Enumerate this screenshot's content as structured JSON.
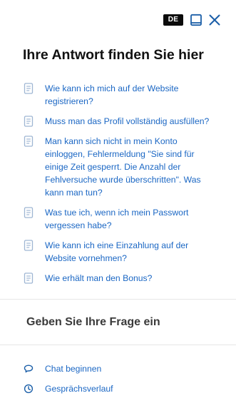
{
  "header": {
    "language": "DE",
    "minimize_icon": "minimize-window-icon",
    "close_icon": "close-icon"
  },
  "title": "Ihre Antwort finden Sie hier",
  "faq": {
    "icon": "document-icon",
    "items": [
      {
        "text": "Wie kann ich mich auf der Website registrieren?"
      },
      {
        "text": "Muss man das Profil vollständig ausfüllen?"
      },
      {
        "text": "Man kann sich nicht in mein Konto einloggen, Fehlermeldung \"Sie sind für einige Zeit gesperrt. Die Anzahl der Fehlversuche wurde überschritten\". Was kann man tun?"
      },
      {
        "text": "Was tue ich, wenn ich mein Passwort vergessen habe?"
      },
      {
        "text": "Wie kann ich eine Einzahlung auf der Website vornehmen?"
      },
      {
        "text": "Wie erhält man den Bonus?"
      }
    ]
  },
  "question_input": {
    "placeholder": "Geben Sie Ihre Frage ein",
    "value": ""
  },
  "footer": {
    "chat": {
      "label": "Chat beginnen",
      "icon": "chat-bubble-icon"
    },
    "history": {
      "label": "Gesprächsverlauf",
      "icon": "clock-icon"
    }
  },
  "colors": {
    "link": "#1b67c4",
    "icon_light": "#9fb6d3",
    "header_icons": "#1b5fa8",
    "badge_bg": "#0b0b0b",
    "badge_text": "#ffffff",
    "title": "#111111",
    "divider": "#e6e6e6"
  }
}
